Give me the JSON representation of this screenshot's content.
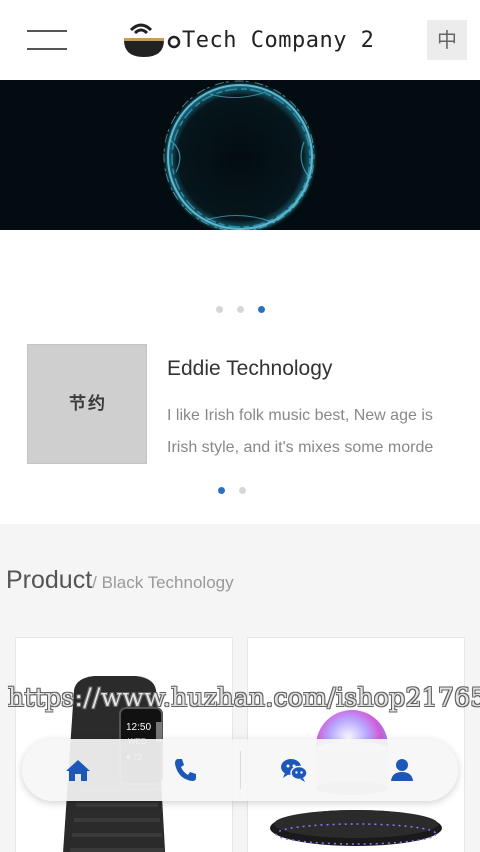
{
  "header": {
    "logo_text": "Tech Company 2",
    "lang_button": "中"
  },
  "banner": {
    "slide_count": 3,
    "active_slide": 3
  },
  "news": {
    "thumbnail_text": "节约",
    "title": "Eddie Technology",
    "desc_line1": "I like Irish folk music best, New age is",
    "desc_line2": "Irish style, and it's mixes some morde",
    "page_count": 2,
    "active_page": 1
  },
  "products": {
    "title": "Product",
    "subtitle": "/ Black Technology",
    "items": [
      {
        "icon": "smart-band"
      },
      {
        "icon": "levitating-speaker"
      }
    ]
  },
  "watermark": "https://www.huzhan.com/ishop21765",
  "bottom_nav": [
    {
      "icon": "home-icon"
    },
    {
      "icon": "phone-icon"
    },
    {
      "icon": "wechat-icon"
    },
    {
      "icon": "user-icon"
    }
  ],
  "colors": {
    "accent": "#2a6fc0",
    "banner_bg": "#030c10",
    "section_bg": "#f5f5f5"
  }
}
